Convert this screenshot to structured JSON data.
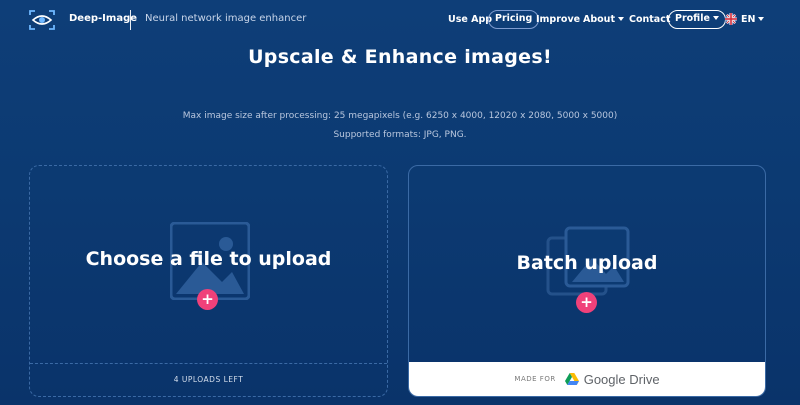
{
  "header": {
    "brand": "Deep-Image",
    "tagline": "Neural network image enhancer",
    "nav": {
      "use_app": "Use App",
      "pricing": "Pricing",
      "improve": "Improve",
      "about": "About",
      "contact": "Contact",
      "profile": "Profile",
      "language": "EN"
    }
  },
  "hero": {
    "title": "Upscale & Enhance images!",
    "max_size": "Max image size after processing: 25 megapixels (e.g. 6250 x 4000, 12020 x 2080, 5000 x 5000)",
    "formats": "Supported formats: JPG, PNG."
  },
  "upload_card": {
    "title": "Choose a file to upload",
    "plus": "+",
    "uploads_left": "4 UPLOADS LEFT"
  },
  "batch_card": {
    "title": "Batch upload",
    "plus": "+",
    "made_for": "MADE FOR",
    "drive_label": "Google Drive"
  },
  "colors": {
    "background": "#0c3a72",
    "accent_plus": "#f0417a",
    "dashed_border": "#3b6aa5"
  }
}
